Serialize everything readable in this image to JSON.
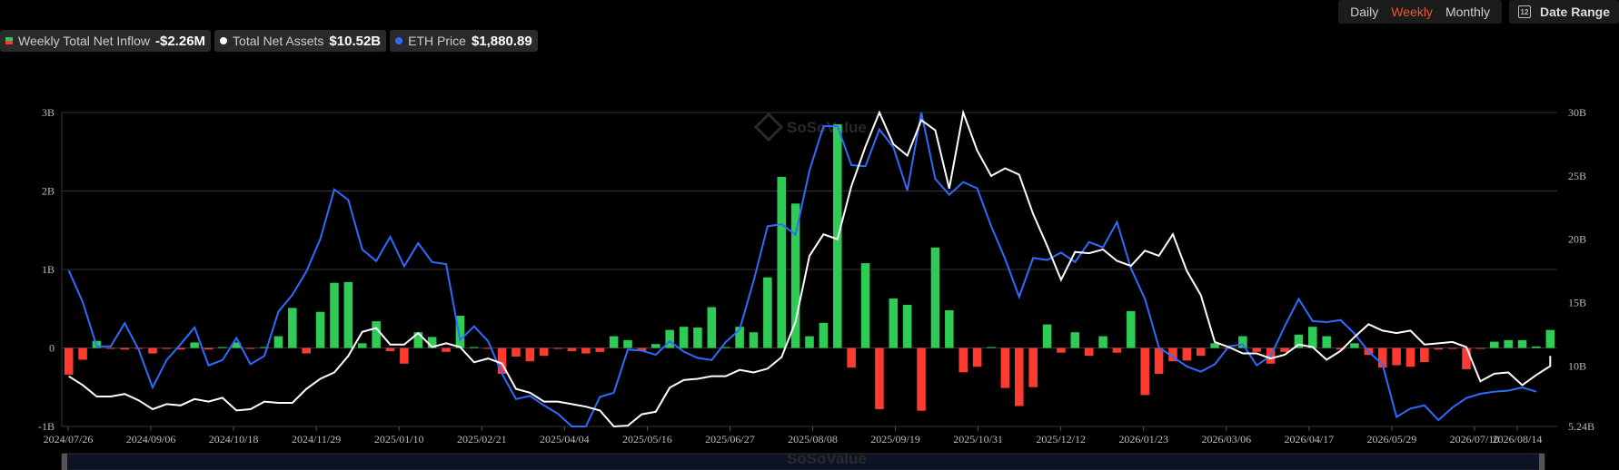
{
  "toolbar": {
    "periods": [
      "Daily",
      "Weekly",
      "Monthly"
    ],
    "active_period": "Weekly",
    "date_range_label": "Date Range",
    "calendar_icon_text": "12"
  },
  "legend": {
    "inflow_label": "Weekly Total Net Inflow",
    "inflow_value": "-$2.26M",
    "assets_label": "Total Net Assets",
    "assets_value": "$10.52B",
    "price_label": "ETH Price",
    "price_value": "$1,880.89"
  },
  "watermark": "SoSoValue",
  "colors": {
    "positive": "#2ecc55",
    "negative": "#ff3b30",
    "assets_line": "#ffffff",
    "price_line": "#2f6bff",
    "accent": "#f0542d"
  },
  "chart_data": {
    "type": "bar",
    "x_ticks": [
      "2024/07/26",
      "2024/09/06",
      "2024/10/18",
      "2024/11/29",
      "2025/01/10",
      "2025/02/21",
      "2025/04/04",
      "2025/05/16",
      "2025/06/27",
      "2025/08/08",
      "2025/09/19",
      "2025/10/31",
      "2025/12/12",
      "2026/01/23",
      "2026/03/06",
      "2026/04/17",
      "2026/05/29",
      "2026/07/10",
      "2026/08/14"
    ],
    "y_left_ticks": [
      "3B",
      "2B",
      "1B",
      "0",
      "-1B"
    ],
    "y_left_range": [
      -1,
      3
    ],
    "y_right_ticks": [
      "30B",
      "25B",
      "20B",
      "15B",
      "10B",
      "5.24B"
    ],
    "y_right_range": [
      5.24,
      30
    ],
    "series": [
      {
        "name": "Weekly Total Net Inflow",
        "unit": "B",
        "values": [
          -0.34,
          -0.15,
          0.09,
          -0.01,
          -0.02,
          -0.01,
          -0.07,
          -0.01,
          -0.02,
          0.07,
          -0.02,
          0.0,
          0.07,
          -0.01,
          0.01,
          0.15,
          0.51,
          -0.07,
          0.46,
          0.83,
          0.84,
          0.06,
          0.34,
          -0.04,
          -0.2,
          0.2,
          0.14,
          -0.05,
          0.41,
          0.0,
          -0.01,
          -0.33,
          -0.11,
          -0.17,
          -0.1,
          -0.01,
          -0.04,
          -0.07,
          -0.05,
          0.15,
          0.1,
          -0.04,
          0.05,
          0.23,
          0.27,
          0.26,
          0.52,
          0.0,
          0.27,
          0.2,
          0.9,
          2.18,
          1.84,
          0.15,
          0.32,
          2.85,
          -0.25,
          1.08,
          -0.78,
          0.63,
          0.55,
          -0.8,
          1.28,
          0.48,
          -0.31,
          -0.24,
          0.01,
          -0.51,
          -0.74,
          -0.5,
          0.3,
          -0.06,
          0.2,
          -0.1,
          0.15,
          -0.06,
          0.47,
          -0.6,
          -0.33,
          -0.17,
          -0.16,
          -0.1,
          0.06,
          -0.01,
          0.15,
          -0.05,
          -0.2,
          -0.05,
          0.17,
          0.27,
          0.15,
          -0.02,
          0.06,
          -0.09,
          -0.25,
          -0.22,
          -0.24,
          -0.18,
          -0.02,
          -0.01,
          -0.27,
          -0.01,
          0.08,
          0.1,
          0.1,
          0.02,
          0.23
        ]
      },
      {
        "name": "Total Net Assets",
        "unit": "B",
        "values": [
          9.2,
          8.5,
          7.6,
          7.6,
          7.8,
          7.3,
          6.6,
          7.0,
          6.9,
          7.4,
          7.2,
          7.5,
          6.5,
          6.6,
          7.2,
          7.1,
          7.1,
          8.2,
          9.0,
          9.5,
          10.8,
          12.7,
          13.0,
          11.7,
          11.7,
          12.6,
          11.5,
          11.8,
          11.5,
          10.3,
          10.6,
          10.2,
          8.2,
          7.9,
          7.2,
          7.2,
          7.0,
          6.8,
          6.5,
          5.24,
          5.3,
          6.2,
          6.4,
          8.3,
          8.9,
          9.0,
          9.2,
          9.2,
          9.7,
          9.5,
          9.8,
          10.7,
          13.5,
          18.7,
          20.4,
          20.0,
          24.2,
          27.3,
          30.0,
          27.5,
          26.6,
          29.4,
          28.6,
          24.0,
          30.0,
          27.0,
          25.0,
          25.6,
          25.1,
          22.0,
          19.5,
          16.8,
          19.0,
          18.9,
          19.2,
          18.3,
          17.9,
          19.1,
          18.7,
          20.4,
          17.5,
          15.6,
          11.9,
          11.5,
          11.0,
          11.0,
          10.6,
          10.9,
          11.7,
          11.5,
          10.5,
          11.2,
          12.3,
          13.3,
          12.8,
          12.6,
          12.8,
          11.7,
          11.8,
          11.9,
          11.5,
          8.8,
          9.4,
          9.5,
          8.5,
          9.3,
          10.0,
          10.3,
          10.3,
          10.8,
          10.6
        ],
        "note_scale": "right"
      },
      {
        "name": "ETH Price",
        "unit": "USD",
        "values": [
          3280,
          2980,
          2560,
          2560,
          2780,
          2530,
          2170,
          2430,
          2580,
          2740,
          2380,
          2430,
          2640,
          2390,
          2470,
          2890,
          3050,
          3270,
          3580,
          4050,
          3950,
          3480,
          3370,
          3600,
          3320,
          3540,
          3360,
          3340,
          2620,
          2750,
          2610,
          2300,
          2060,
          2090,
          2000,
          1920,
          1800,
          1800,
          2080,
          2120,
          2530,
          2520,
          2480,
          2610,
          2510,
          2450,
          2430,
          2600,
          2720,
          3180,
          3700,
          3720,
          3620,
          4230,
          4650,
          4650,
          4280,
          4270,
          4620,
          4450,
          4040,
          4780,
          4150,
          4000,
          4120,
          4060,
          3700,
          3390,
          3030,
          3400,
          3380,
          3450,
          3360,
          3550,
          3500,
          3740,
          3300,
          3010,
          2550,
          2460,
          2370,
          2320,
          2390,
          2560,
          2580,
          2380,
          2470,
          2750,
          3010,
          2800,
          2790,
          2810,
          2680,
          2510,
          2390,
          1890,
          1970,
          2000,
          1860,
          1980,
          2070,
          2110,
          2130,
          2140,
          2170,
          2130
        ]
      }
    ],
    "grid": true,
    "legend_position": "top-left"
  }
}
